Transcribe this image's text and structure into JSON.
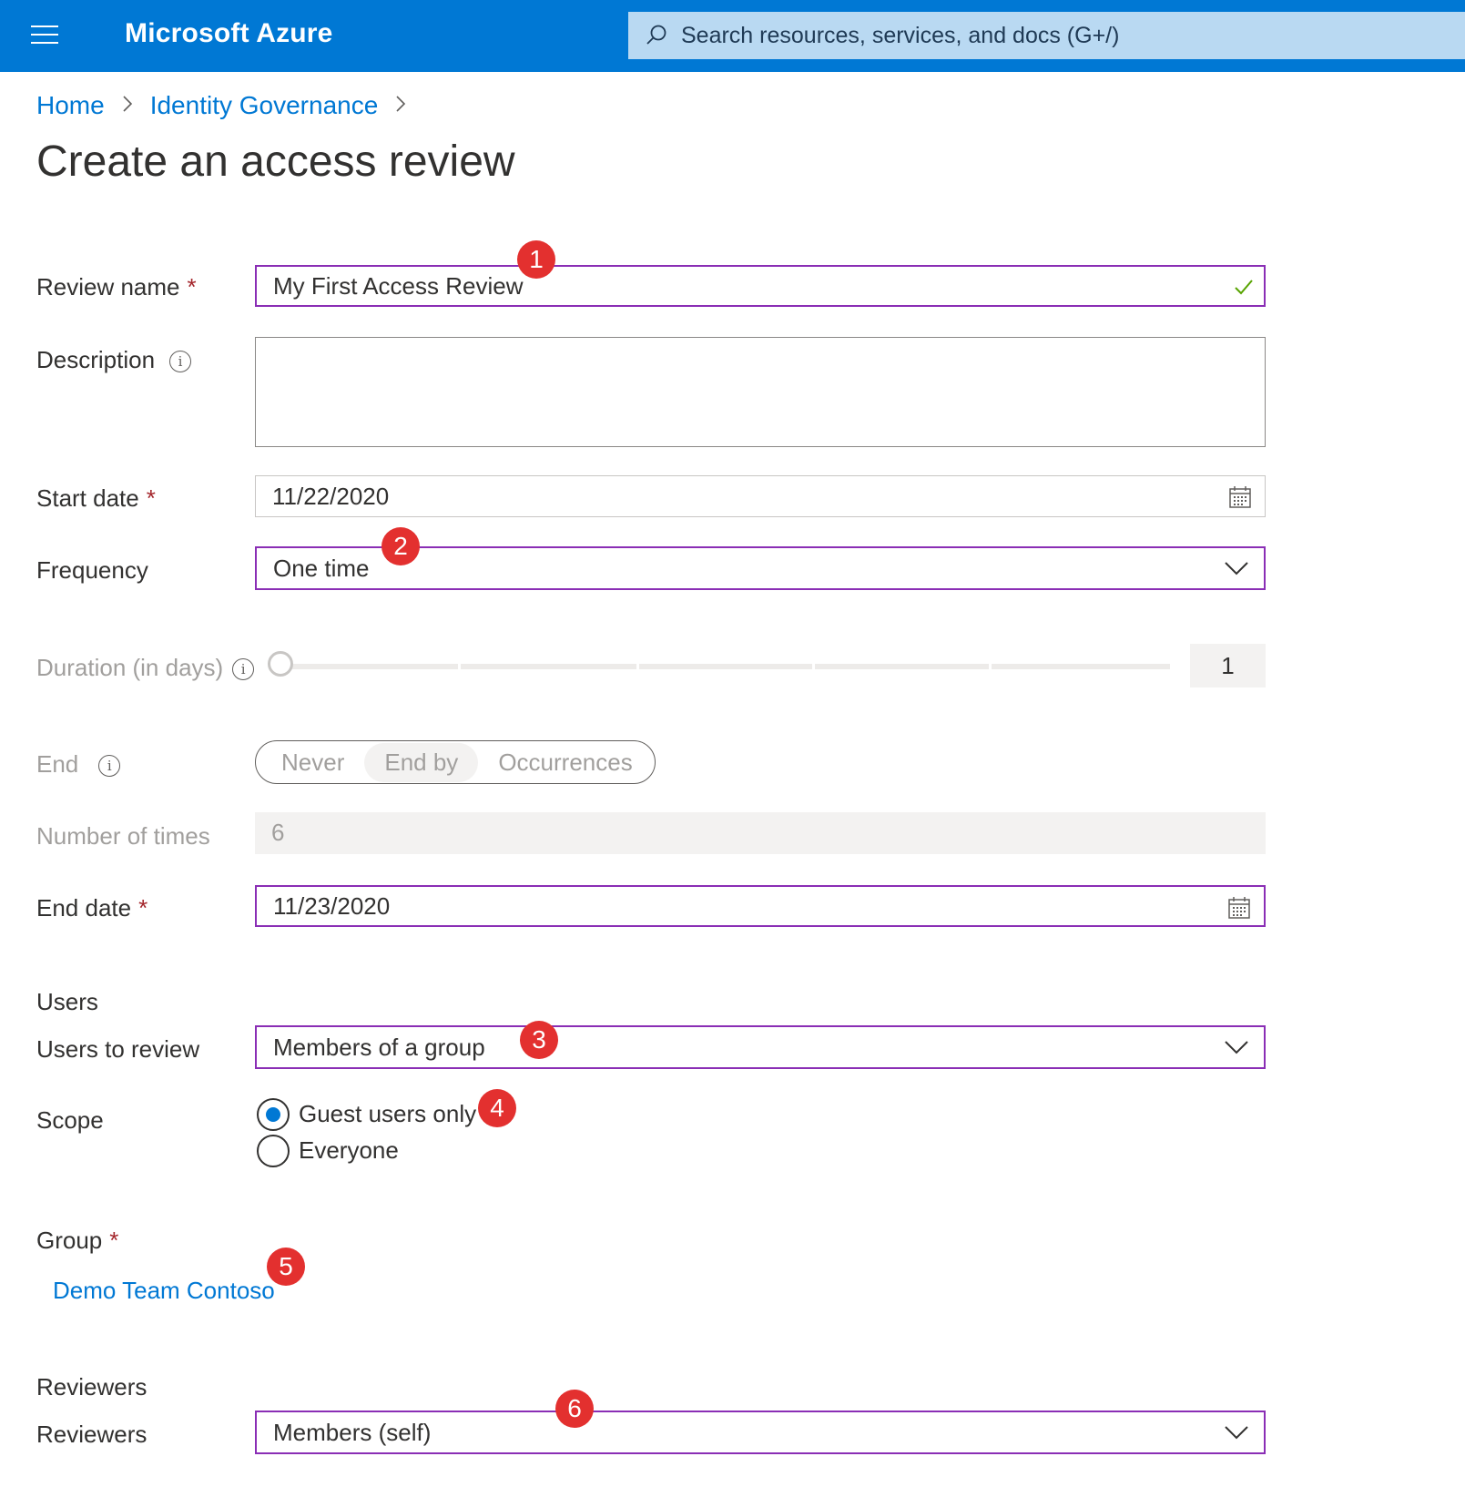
{
  "topbar": {
    "brand": "Microsoft Azure",
    "search_placeholder": "Search resources, services, and docs (G+/)"
  },
  "breadcrumb": {
    "items": [
      "Home",
      "Identity Governance"
    ]
  },
  "page_title": "Create an access review",
  "form": {
    "review_name": {
      "label": "Review name",
      "value": "My First Access Review",
      "required": "*"
    },
    "description": {
      "label": "Description",
      "info": "i",
      "value": ""
    },
    "start_date": {
      "label": "Start date",
      "value": "11/22/2020",
      "required": "*"
    },
    "frequency": {
      "label": "Frequency",
      "value": "One time"
    },
    "duration": {
      "label": "Duration (in days)",
      "info": "i",
      "value": "1"
    },
    "end": {
      "label": "End",
      "info": "i",
      "options": [
        "Never",
        "End by",
        "Occurrences"
      ],
      "selected": "End by"
    },
    "number_of_times": {
      "label": "Number of times",
      "value": "6"
    },
    "end_date": {
      "label": "End date",
      "value": "11/23/2020",
      "required": "*"
    },
    "users_section": "Users",
    "users_to_review": {
      "label": "Users to review",
      "value": "Members of a group"
    },
    "scope": {
      "label": "Scope",
      "options": [
        "Guest users only",
        "Everyone"
      ],
      "selected": "Guest users only"
    },
    "group": {
      "label": "Group",
      "required": "*",
      "value": "Demo Team Contoso"
    },
    "reviewers_section": "Reviewers",
    "reviewers": {
      "label": "Reviewers",
      "value": "Members (self)"
    }
  },
  "callouts": [
    "1",
    "2",
    "3",
    "4",
    "5",
    "6"
  ],
  "colors": {
    "topbar": "#0078d4",
    "accent_border": "#8a2eb5",
    "link": "#0078d4",
    "callout": "#e3302f",
    "required": "#a4262c"
  }
}
